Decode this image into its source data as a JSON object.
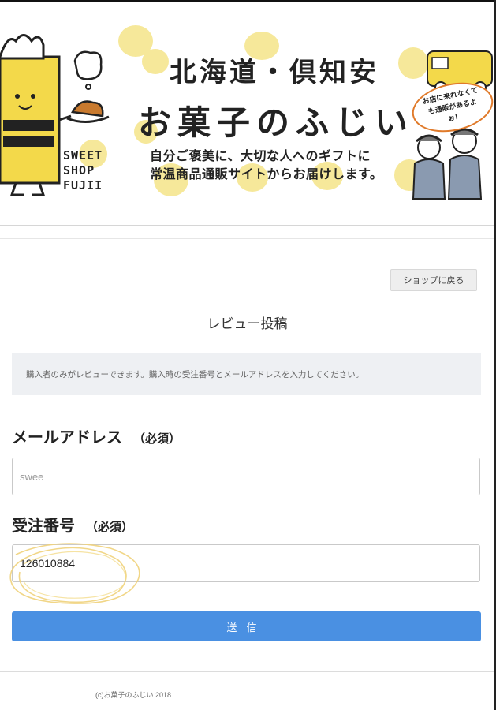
{
  "banner": {
    "heading_line1": "北海道・倶知安",
    "heading_line2": "お菓子のふじい",
    "subtext_line1": "自分ご褒美に、大切な人へのギフトに",
    "subtext_line2": "常温商品通販サイトからお届けします。",
    "brand_lines": [
      "SWEET",
      "SHOP",
      "FUJII"
    ],
    "bubble_text": "お店に来れなくても通販があるよぉ！",
    "accent_color": "#f6e89a"
  },
  "nav": {
    "back_label": "ショップに戻る"
  },
  "page": {
    "title": "レビュー投稿",
    "notice": "購入者のみがレビューできます。購入時の受注番号とメールアドレスを入力してください。"
  },
  "form": {
    "email": {
      "label": "メールアドレス",
      "required": "（必須）",
      "value": "swee"
    },
    "order": {
      "label": "受注番号",
      "required": "（必須）",
      "value": "126010884"
    },
    "submit_label": "送信",
    "submit_color": "#4a90e2"
  },
  "footer": {
    "copyright": "(c)お菓子のふじい 2018"
  }
}
